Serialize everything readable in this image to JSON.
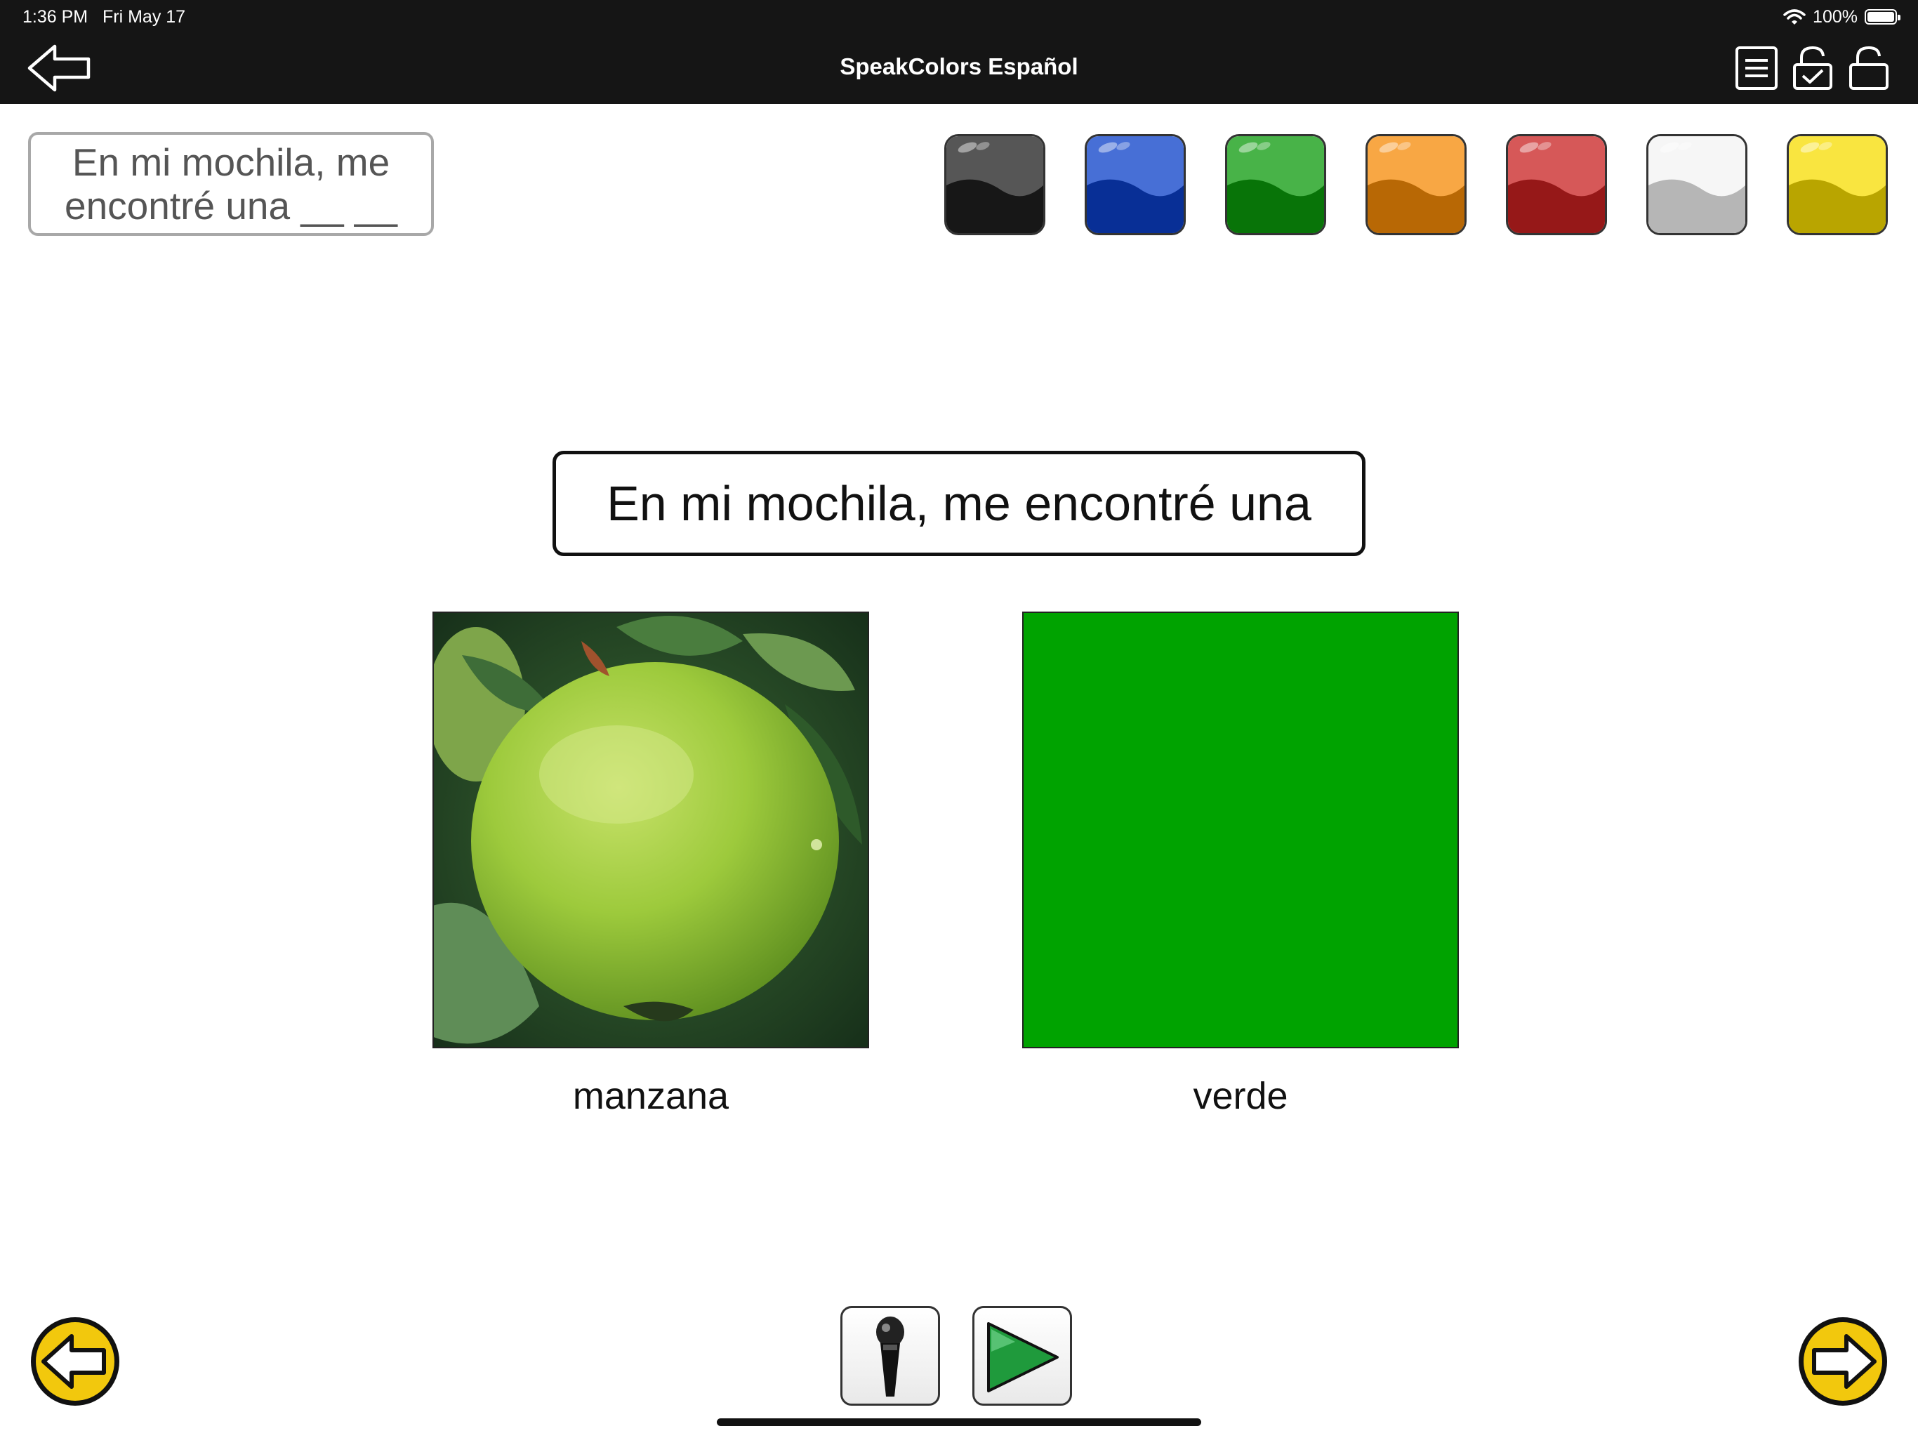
{
  "status_bar": {
    "time": "1:36 PM",
    "date": "Fri May 17",
    "battery": "100%"
  },
  "header": {
    "title": "SpeakColors Español"
  },
  "prompt": {
    "text": "En mi mochila, me encontré una __ __"
  },
  "swatches": [
    {
      "color": "#1e1e1e",
      "name": "black"
    },
    {
      "color": "#0a3fc8",
      "name": "blue"
    },
    {
      "color": "#0b9a0b",
      "name": "green"
    },
    {
      "color": "#f58a06",
      "name": "orange"
    },
    {
      "color": "#c82020",
      "name": "red"
    },
    {
      "color": "#f3f3f3",
      "name": "white"
    },
    {
      "color": "#f7dc00",
      "name": "yellow"
    }
  ],
  "sentence": {
    "text": "En mi mochila, me encontré una"
  },
  "cards": [
    {
      "label": "manzana",
      "image": "green-apple"
    },
    {
      "label": "verde",
      "color": "#00a300"
    }
  ],
  "accent": {
    "yellow": "#f2c80d"
  }
}
